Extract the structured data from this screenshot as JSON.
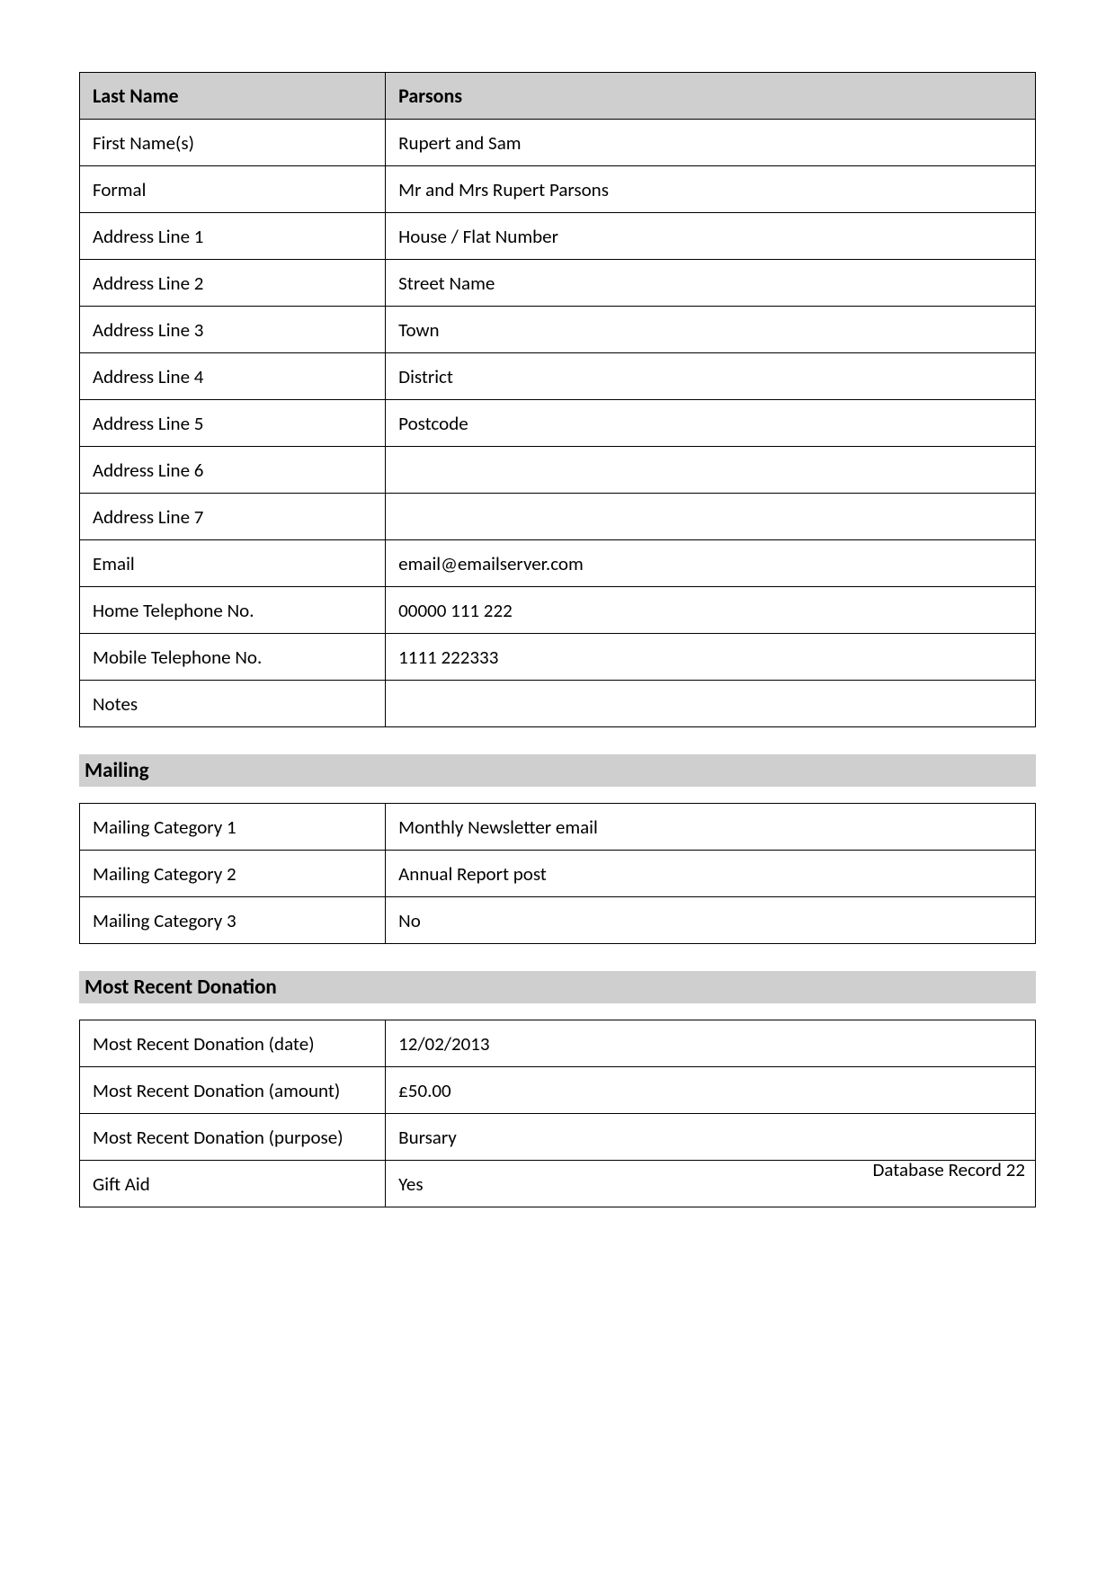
{
  "contact": {
    "header_label": "Last Name",
    "header_value": "Parsons",
    "rows": [
      {
        "label": "First Name(s)",
        "value": "Rupert and Sam"
      },
      {
        "label": "Formal",
        "value": "Mr and Mrs Rupert Parsons"
      },
      {
        "label": "Address Line 1",
        "value": "House / Flat Number"
      },
      {
        "label": "Address Line 2",
        "value": "Street Name"
      },
      {
        "label": "Address Line 3",
        "value": "Town"
      },
      {
        "label": "Address Line 4",
        "value": "District"
      },
      {
        "label": "Address Line 5",
        "value": "Postcode"
      },
      {
        "label": "Address Line 6",
        "value": ""
      },
      {
        "label": "Address Line 7",
        "value": ""
      },
      {
        "label": "Email",
        "value": "email@emailserver.com"
      },
      {
        "label": "Home Telephone No.",
        "value": "00000 111 222"
      },
      {
        "label": "Mobile Telephone No.",
        "value": "1111 222333"
      },
      {
        "label": "Notes",
        "value": ""
      }
    ]
  },
  "mailing": {
    "heading": "Mailing",
    "rows": [
      {
        "label": "Mailing Category 1",
        "value": "Monthly Newsletter email"
      },
      {
        "label": "Mailing Category 2",
        "value": "Annual Report post"
      },
      {
        "label": "Mailing Category 3",
        "value": "No"
      }
    ]
  },
  "donation": {
    "heading": "Most Recent Donation",
    "rows": [
      {
        "label": "Most Recent Donation (date)",
        "value": "12/02/2013"
      },
      {
        "label": "Most Recent Donation (amount)",
        "value": "£50.00"
      },
      {
        "label": "Most Recent Donation (purpose)",
        "value": "Bursary"
      },
      {
        "label": "Gift Aid",
        "value": "Yes"
      }
    ]
  },
  "footer": "Database Record 22"
}
